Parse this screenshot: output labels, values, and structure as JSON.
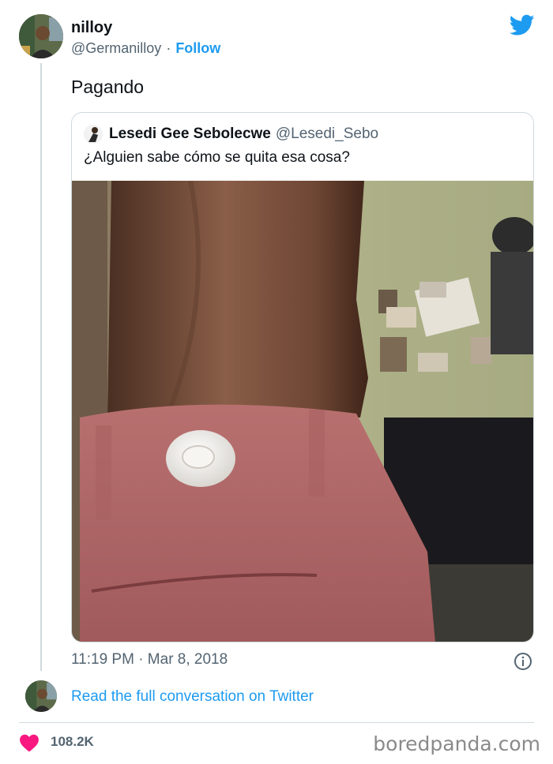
{
  "tweet": {
    "display_name": "nilloy",
    "handle": "@Germanilloy",
    "separator": "·",
    "follow_label": "Follow",
    "text": "Pagando",
    "timestamp": "11:19 PM · Mar 8, 2018",
    "read_conversation_label": "Read the full conversation on Twitter",
    "likes": "108.2K"
  },
  "quote": {
    "display_name": "Lesedi Gee Sebolecwe",
    "handle": "@Lesedi_Sebo",
    "text": "¿Alguien sabe cómo se quita esa cosa?"
  },
  "watermark": "boredpanda.com",
  "colors": {
    "accent": "#1d9bf0",
    "like": "#f91880",
    "muted": "#536471",
    "border": "#cfd9de"
  }
}
